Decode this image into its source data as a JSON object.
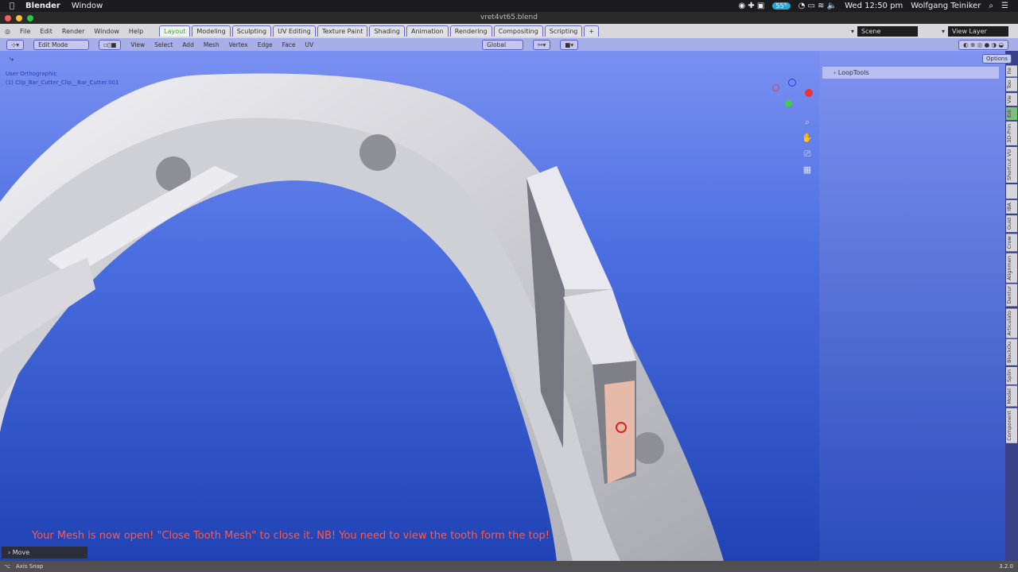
{
  "macos": {
    "app": "Blender",
    "menu": [
      "Window"
    ],
    "temp": "55°",
    "clock": "Wed 12:50 pm",
    "user": "Wolfgang Teiniker"
  },
  "window": {
    "title": "vret4vt65.blend"
  },
  "topbar": {
    "menus": [
      "File",
      "Edit",
      "Render",
      "Window",
      "Help"
    ],
    "workspaces": [
      "Layout",
      "Modeling",
      "Sculpting",
      "UV Editing",
      "Texture Paint",
      "Shading",
      "Animation",
      "Rendering",
      "Compositing",
      "Scripting",
      "+"
    ],
    "scene": "Scene",
    "view_layer": "View Layer"
  },
  "header": {
    "mode": "Edit Mode",
    "menus": [
      "View",
      "Select",
      "Add",
      "Mesh",
      "Vertex",
      "Edge",
      "Face",
      "UV"
    ],
    "orientation": "Global",
    "options": "Options",
    "axes": [
      "X",
      "Y",
      "Z"
    ]
  },
  "viewport": {
    "view_name": "User Orthographic",
    "object": "(1) Clip_Bar_Cutter_Clip__Bar_Cutter.001",
    "message": "Your Mesh is now open! \"Close Tooth Mesh\" to close it. NB! You need to view the tooth form the top!",
    "last_op": "Move"
  },
  "npanel": {
    "panel": "LoopTools"
  },
  "side_tabs": [
    "Ite",
    "Too",
    "Vie",
    "Edi",
    "3D-Prin",
    "Shortcut VU",
    "",
    "IBA",
    "Guid",
    "Crow",
    "Alignmen",
    "Dentur",
    "Articulato",
    "BlockOu",
    "Splin",
    "Model",
    "Component"
  ],
  "status": {
    "left": "Axis Snap",
    "version": "3.2.0"
  },
  "colors": {
    "accent": "#4c9a4c",
    "message": "#ff5a4a"
  }
}
